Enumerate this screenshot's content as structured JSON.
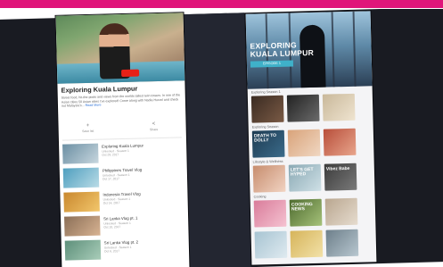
{
  "colors": {
    "magenta": "#e0157a",
    "backdrop": "#191b22",
    "youtube_red": "#e62117",
    "link_blue": "#2a6fd6",
    "hero_accent": "#3fb1c9"
  },
  "left_screen": {
    "video_title": "Exploring Kuala Lumpur",
    "description": "Street food, hit-the-pools and views from the worlds tallest twin towers. In one of the Asian cities 50 Asian cities I've explored! Come along with Nadia Hurzel and check out Malaysia's...",
    "read_more": "Read More",
    "actions": [
      {
        "icon": "add-icon",
        "label": "Save list"
      },
      {
        "icon": "share-icon",
        "label": "Share"
      }
    ],
    "episodes": [
      {
        "title": "Exploring Kuala Lumpur",
        "meta_line1": "Unlocked · Season 1",
        "meta_line2": "Oct 29, 2017"
      },
      {
        "title": "Philippines Travel Vlog",
        "meta_line1": "Unlocked · Season 1",
        "meta_line2": "Oct 17, 2017"
      },
      {
        "title": "Indonesia Travel Vlog",
        "meta_line1": "Unlocked · Season 1",
        "meta_line2": "Oct 14, 2017"
      },
      {
        "title": "Sri Lanka Vlog pt. 1",
        "meta_line1": "Unlocked · Season 1",
        "meta_line2": "Oct 10, 2017"
      },
      {
        "title": "Sri Lanka Vlog pt. 2",
        "meta_line1": "Unlocked · Season 1",
        "meta_line2": "Oct 6, 2017"
      }
    ]
  },
  "right_screen": {
    "hero_title_line1": "EXPLORING",
    "hero_title_line2": "KUALA LUMPUR",
    "hero_subtitle": "EPISODE 1",
    "rows": [
      {
        "label": "Exploring Season 1",
        "tiles": [
          {
            "text": ""
          },
          {
            "text": ""
          },
          {
            "text": ""
          }
        ]
      },
      {
        "label": "Exploring Season",
        "tiles": [
          {
            "text": "DEATH TO DOLLY"
          },
          {
            "text": ""
          },
          {
            "text": ""
          }
        ]
      },
      {
        "label": "Lifestyle & Wellness",
        "tiles": [
          {
            "text": ""
          },
          {
            "text": "LET'S GET HYPED"
          },
          {
            "text": "Vibez Babe"
          }
        ]
      },
      {
        "label": "Cooking",
        "tiles": [
          {
            "text": ""
          },
          {
            "text": "COOKING NEWS"
          },
          {
            "text": ""
          }
        ]
      }
    ]
  }
}
